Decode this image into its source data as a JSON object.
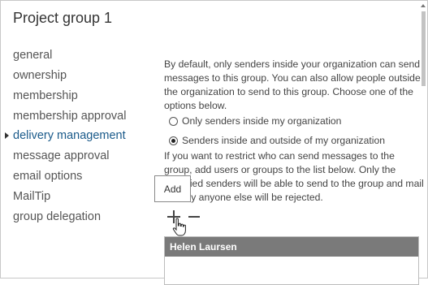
{
  "title": "Project group 1",
  "nav": {
    "items": [
      {
        "label": "general",
        "active": false
      },
      {
        "label": "ownership",
        "active": false
      },
      {
        "label": "membership",
        "active": false
      },
      {
        "label": "membership approval",
        "active": false
      },
      {
        "label": "delivery management",
        "active": true
      },
      {
        "label": "message approval",
        "active": false
      },
      {
        "label": "email options",
        "active": false
      },
      {
        "label": "MailTip",
        "active": false
      },
      {
        "label": "group delegation",
        "active": false
      }
    ]
  },
  "content": {
    "intro_text": "By default, only senders inside your organization can send messages to this group. You can also allow people outside the organization to send to this group. Choose one of the options below.",
    "options": [
      {
        "label": "Only senders inside my organization",
        "checked": false
      },
      {
        "label": "Senders inside and outside of my organization",
        "checked": true
      }
    ],
    "restrict_text": "If you want to restrict who can send messages to the group, add users or groups to the list below. Only the specified senders will be able to send to the group and mail sent by anyone else will be rejected.",
    "add_tooltip": "Add",
    "list_header": "Helen Laursen"
  },
  "icons": {
    "add": "plus-icon",
    "remove": "minus-icon",
    "cursor": "hand-pointer-icon",
    "nav_marker": "caret-right-icon",
    "scroll_up": "scroll-up-arrow-icon"
  },
  "colors": {
    "active_nav": "#1a5a8a",
    "list_header_bg": "#7a7a7a"
  }
}
